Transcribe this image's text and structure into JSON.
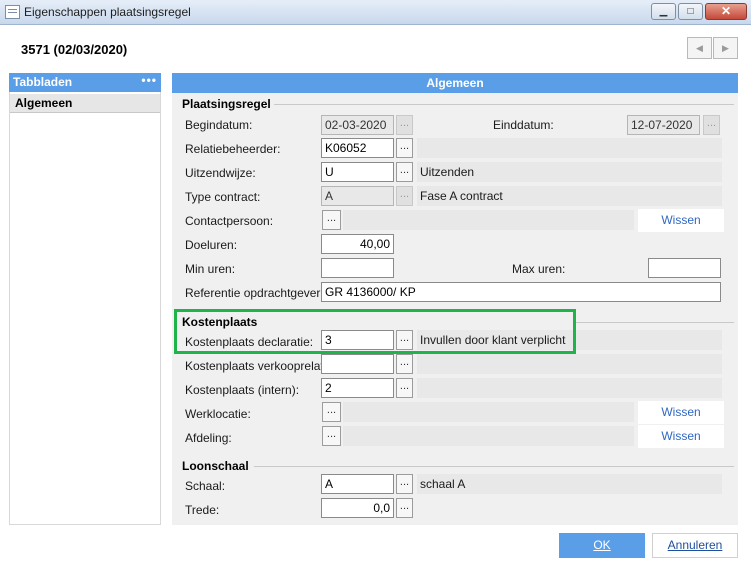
{
  "window": {
    "title": "Eigenschappen plaatsingsregel",
    "minimize_glyph": "▁",
    "maximize_glyph": "□",
    "close_glyph": "✕"
  },
  "header": {
    "title": "3571 (02/03/2020)",
    "prev_glyph": "◀",
    "next_glyph": "▶"
  },
  "tabs": {
    "header": "Tabbladen",
    "more": "•••",
    "items": [
      {
        "label": "Algemeen",
        "selected": true
      }
    ]
  },
  "main": {
    "header": "Algemeen",
    "plaatsingsregel": {
      "title": "Plaatsingsregel",
      "begindatum_label": "Begindatum:",
      "begindatum": "02-03-2020",
      "einddatum_label": "Einddatum:",
      "einddatum": "12-07-2020",
      "relatiebeheerder_label": "Relatiebeheerder:",
      "relatiebeheerder": "K06052",
      "relatiebeheerder_desc": "",
      "uitzendwijze_label": "Uitzendwijze:",
      "uitzendwijze": "U",
      "uitzendwijze_desc": "Uitzenden",
      "type_contract_label": "Type contract:",
      "type_contract": "A",
      "type_contract_desc": "Fase A contract",
      "contactpersoon_label": "Contactpersoon:",
      "contactpersoon_desc": "",
      "contactpersoon_clear": "Wissen",
      "doeluren_label": "Doeluren:",
      "doeluren": "40,00",
      "min_uren_label": "Min uren:",
      "min_uren": "",
      "max_uren_label": "Max uren:",
      "max_uren": "",
      "referentie_label": "Referentie opdrachtgever:",
      "referentie": "GR 4136000/ KP"
    },
    "kostenplaats": {
      "title": "Kostenplaats",
      "declaratie_label": "Kostenplaats declaratie:",
      "declaratie": "3",
      "declaratie_desc": "Invullen door klant verplicht",
      "verkooprelatie_label": "Kostenplaats verkooprelatie:",
      "verkooprelatie": "",
      "verkooprelatie_desc": "",
      "intern_label": "Kostenplaats (intern):",
      "intern": "2",
      "intern_desc": "",
      "werklocatie_label": "Werklocatie:",
      "werklocatie_desc": "",
      "werklocatie_clear": "Wissen",
      "afdeling_label": "Afdeling:",
      "afdeling_desc": "",
      "afdeling_clear": "Wissen"
    },
    "loonschaal": {
      "title": "Loonschaal",
      "schaal_label": "Schaal:",
      "schaal": "A",
      "schaal_desc": "schaal A",
      "trede_label": "Trede:",
      "trede": "0,0"
    }
  },
  "lookup_glyph": "...",
  "footer": {
    "ok": "OK",
    "cancel": "Annuleren"
  },
  "colors": {
    "accent": "#5a9ee8",
    "highlight": "#1fb34a",
    "link": "#2f68c4"
  }
}
